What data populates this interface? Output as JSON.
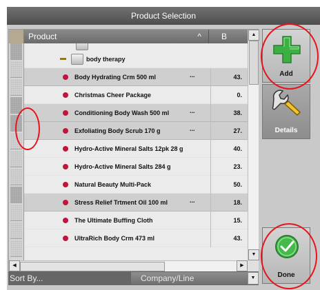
{
  "window": {
    "title": "Product Selection"
  },
  "grid": {
    "columns": {
      "product": "Product",
      "second": "B"
    },
    "category": {
      "name": "body therapy"
    },
    "rows": [
      {
        "name": "Body Hydrating Crm 500 ml",
        "value": "43.",
        "ellipsis": "...",
        "selected": true
      },
      {
        "name": "Christmas Cheer Package",
        "value": "0.",
        "ellipsis": "",
        "selected": false
      },
      {
        "name": "Conditioning Body Wash 500 ml",
        "value": "38.",
        "ellipsis": "...",
        "selected": true
      },
      {
        "name": "Exfoliating Body Scrub 170 g",
        "value": "27.",
        "ellipsis": "...",
        "selected": true
      },
      {
        "name": "Hydro-Active Mineral Salts 12pk 28 g",
        "value": "40.",
        "ellipsis": "",
        "selected": false
      },
      {
        "name": "Hydro-Active Mineral Salts 284 g",
        "value": "23.",
        "ellipsis": "",
        "selected": false
      },
      {
        "name": "Natural Beauty Multi-Pack",
        "value": "50.",
        "ellipsis": "",
        "selected": false
      },
      {
        "name": "Stress Relief Trtment Oil 100 ml",
        "value": "18.",
        "ellipsis": "...",
        "selected": true
      },
      {
        "name": "The Ultimate Buffing Cloth",
        "value": "15.",
        "ellipsis": "",
        "selected": false
      },
      {
        "name": "UltraRich Body Crm 473 ml",
        "value": "43.",
        "ellipsis": "",
        "selected": false
      }
    ]
  },
  "sort": {
    "label": "Sort By...",
    "value": "Company/Line"
  },
  "actions": {
    "add": "Add",
    "details": "Details",
    "done": "Done"
  },
  "colors": {
    "accent_green": "#3cb043",
    "bullet": "#c2133d",
    "annotation": "#e8121a"
  },
  "icons": [
    "sort-ascending-icon",
    "plus-icon",
    "wrench-icon",
    "checkmark-icon",
    "bullet-icon",
    "category-box-icon"
  ]
}
